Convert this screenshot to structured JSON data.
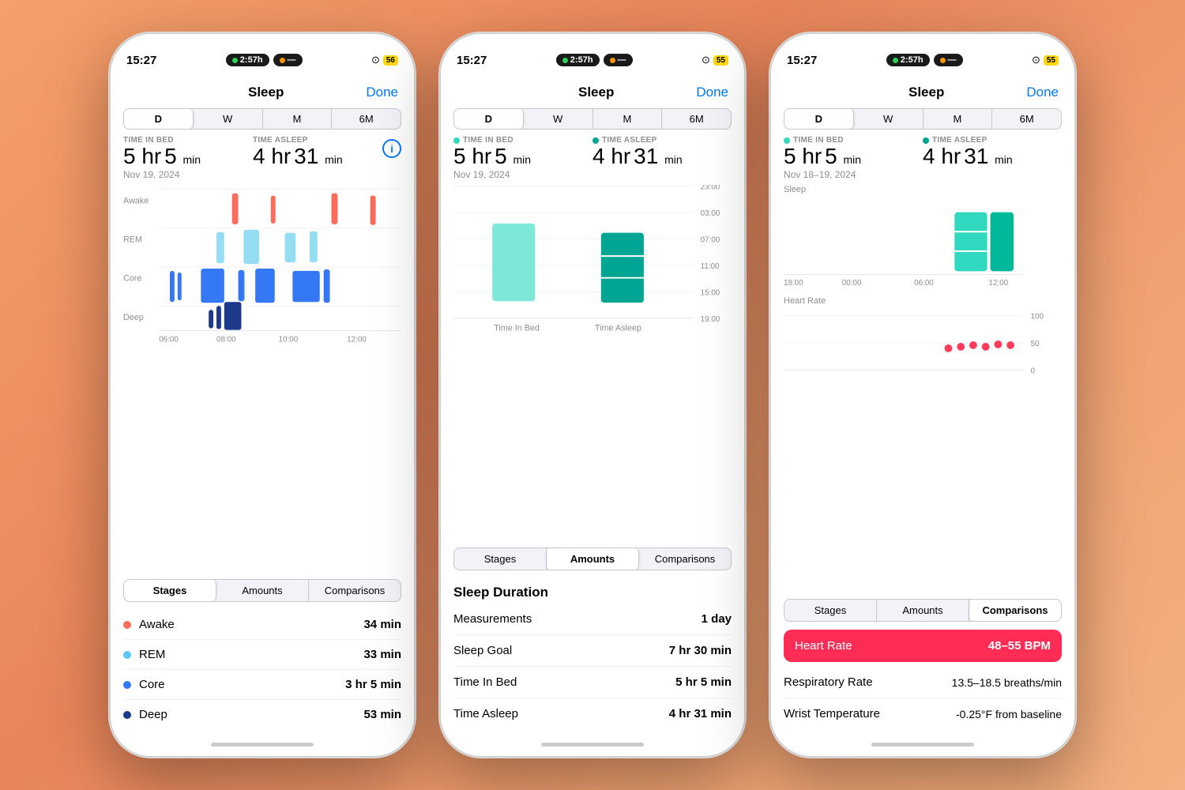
{
  "background": "#f0956a",
  "phones": [
    {
      "id": "phone1",
      "statusBar": {
        "time": "15:27",
        "centerLeft": "2:57h",
        "battery": "56"
      },
      "title": "Sleep",
      "doneLabel": "Done",
      "tabs": [
        "D",
        "W",
        "M",
        "6M"
      ],
      "activeTab": "D",
      "stats": {
        "timeInBed": {
          "label": "TIME IN BED",
          "value": "5 hr 5 min"
        },
        "timeAsleep": {
          "label": "TIME ASLEEP",
          "value": "4 hr 31 min"
        }
      },
      "date": "Nov 19, 2024",
      "chartLabels": {
        "rows": [
          "Awake",
          "REM",
          "Core",
          "Deep"
        ],
        "xAxis": [
          "06:00",
          "08:00",
          "10:00",
          "12:00"
        ]
      },
      "bottomTabs": [
        "Stages",
        "Amounts",
        "Comparisons"
      ],
      "activeBottomTab": "Stages",
      "stages": [
        {
          "name": "Awake",
          "color": "#ff6b5b",
          "time": "34 min"
        },
        {
          "name": "REM",
          "color": "#5ac8fa",
          "time": "33 min"
        },
        {
          "name": "Core",
          "color": "#3478f6",
          "time": "3 hr 5 min"
        },
        {
          "name": "Deep",
          "color": "#1d3a8a",
          "time": "53 min"
        }
      ]
    },
    {
      "id": "phone2",
      "statusBar": {
        "time": "15:27",
        "centerLeft": "2:57h",
        "battery": "55"
      },
      "title": "Sleep",
      "doneLabel": "Done",
      "tabs": [
        "D",
        "W",
        "M",
        "6M"
      ],
      "activeTab": "D",
      "stats": {
        "timeInBed": {
          "label": "TIME IN BED",
          "dotColor": "#30d8c0",
          "value": "5 hr 5 min"
        },
        "timeAsleep": {
          "label": "TIME ASLEEP",
          "dotColor": "#00a693",
          "value": "4 hr 31 min"
        }
      },
      "date": "Nov 19, 2024",
      "yAxisLabels": [
        "23:00",
        "03:00",
        "07:00",
        "11:00",
        "15:00",
        "19:00"
      ],
      "chartCols": [
        {
          "label": "Time In Bed",
          "color": "#7ee8d8",
          "heightPct": 55,
          "topOffsetPct": 28
        },
        {
          "label": "Time Asleep",
          "color": "#00a693",
          "heightPct": 45,
          "topOffsetPct": 35,
          "segments": 3
        }
      ],
      "bottomTabs": [
        "Stages",
        "Amounts",
        "Comparisons"
      ],
      "activeBottomTab": "Amounts",
      "amountsSectionTitle": "Sleep Duration",
      "amounts": [
        {
          "label": "Measurements",
          "value": "1 day"
        },
        {
          "label": "Sleep Goal",
          "value": "7 hr 30 min"
        },
        {
          "label": "Time In Bed",
          "value": "5 hr 5 min"
        },
        {
          "label": "Time Asleep",
          "value": "4 hr 31 min"
        }
      ]
    },
    {
      "id": "phone3",
      "statusBar": {
        "time": "15:27",
        "centerLeft": "2:57h",
        "battery": "55"
      },
      "title": "Sleep",
      "doneLabel": "Done",
      "tabs": [
        "D",
        "W",
        "M",
        "6M"
      ],
      "activeTab": "D",
      "stats": {
        "timeInBed": {
          "label": "TIME IN BED",
          "dotColor": "#30d8c0",
          "value": "5 hr 5 min"
        },
        "timeAsleep": {
          "label": "TIME ASLEEP",
          "dotColor": "#00a693",
          "value": "4 hr 31 min"
        }
      },
      "date": "Nov 18–19, 2024",
      "sleepLabel": "Sleep",
      "heartRateLabel": "Heart Rate",
      "xAxisLabels": [
        "18:00",
        "00:00",
        "06:00",
        "12:00"
      ],
      "yAxisHR": [
        "100",
        "50",
        "0"
      ],
      "bottomTabs": [
        "Stages",
        "Amounts",
        "Comparisons"
      ],
      "activeBottomTab": "Comparisons",
      "comparisons": [
        {
          "label": "Heart Rate",
          "value": "48–55 BPM",
          "highlighted": true
        },
        {
          "label": "Respiratory Rate",
          "value": "13.5–18.5 breaths/min",
          "highlighted": false
        },
        {
          "label": "Wrist Temperature",
          "value": "-0.25°F from baseline",
          "highlighted": false
        }
      ]
    }
  ]
}
